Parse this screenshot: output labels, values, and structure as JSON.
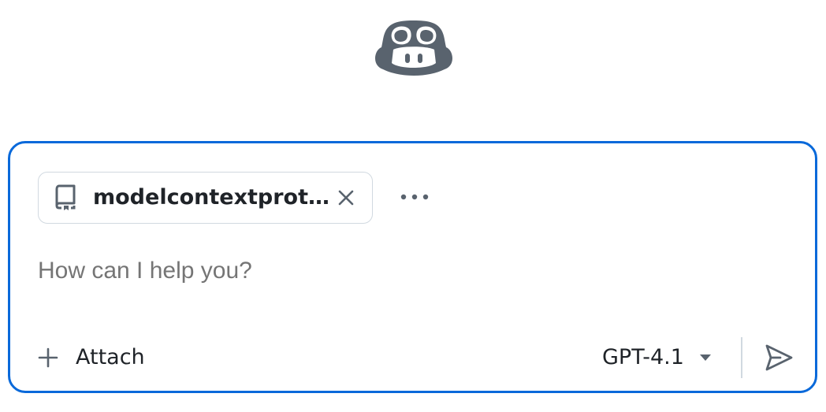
{
  "app": {
    "logo_icon": "copilot-icon"
  },
  "composer": {
    "border_color": "#0969da",
    "repo_chip": {
      "icon": "repo-icon",
      "label": "modelcontextprot...",
      "close_icon": "close-icon"
    },
    "more_icon": "kebab-horizontal-icon",
    "prompt_placeholder": "How can I help you?",
    "attach": {
      "icon": "plus-icon",
      "label": "Attach"
    },
    "model": {
      "label": "GPT-4.1",
      "caret_icon": "triangle-down-icon"
    },
    "send_icon": "paper-airplane-icon"
  }
}
